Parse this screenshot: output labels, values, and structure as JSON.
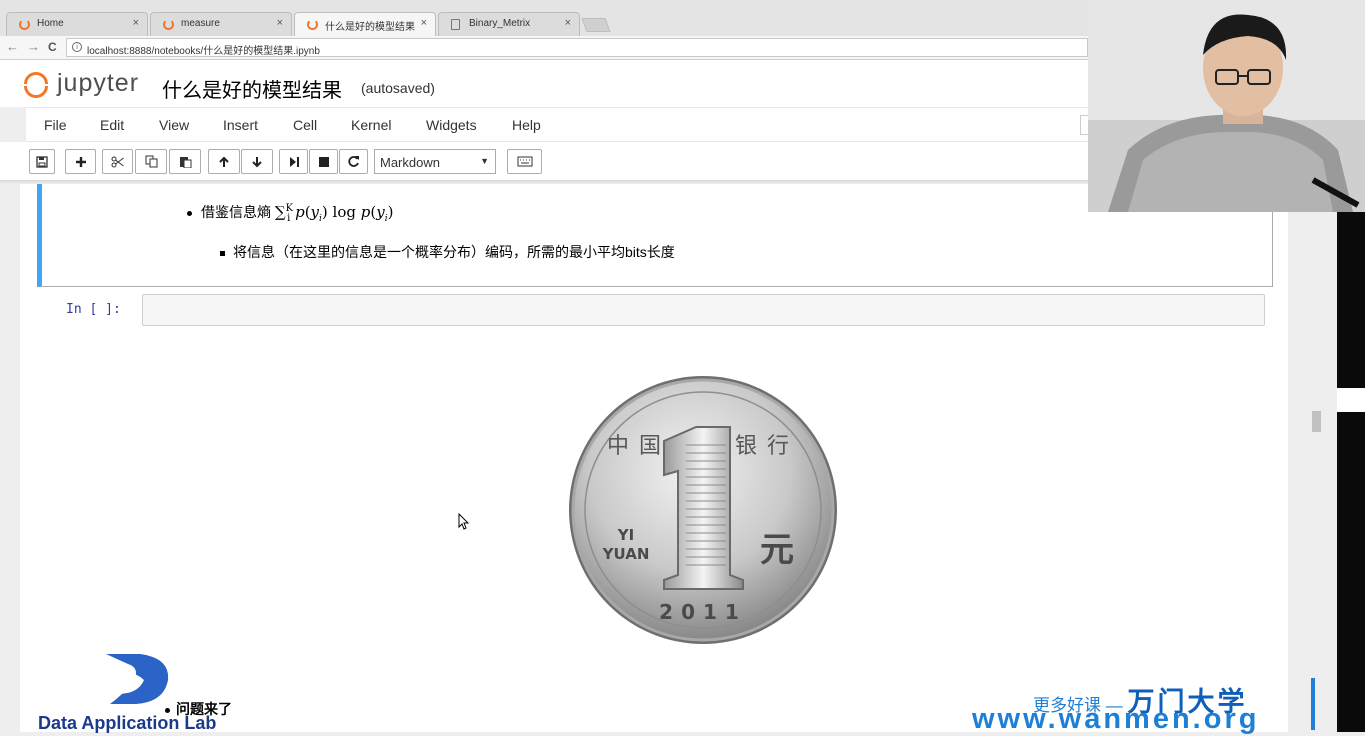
{
  "browser": {
    "tabs": [
      {
        "label": "Home",
        "active": false
      },
      {
        "label": "measure",
        "active": false
      },
      {
        "label": "什么是好的模型结果",
        "active": true
      },
      {
        "label": "Binary_Metrix",
        "active": false
      }
    ],
    "close_glyph": "×",
    "back_glyph": "←",
    "forward_glyph": "→",
    "reload_glyph": "C",
    "url": "localhost:8888/notebooks/什么是好的模型结果.ipynb"
  },
  "jupyter": {
    "logo_text": "jupyter",
    "notebook_title": "什么是好的模型结果",
    "save_status": "(autosaved)",
    "menu": [
      "File",
      "Edit",
      "View",
      "Insert",
      "Cell",
      "Kernel",
      "Widgets",
      "Help"
    ],
    "toolbar": {
      "cell_type": "Markdown",
      "buttons": [
        "save-icon",
        "plus-icon",
        "cut-icon",
        "copy-icon",
        "paste-icon",
        "arrow-up-icon",
        "arrow-down-icon",
        "run-icon",
        "stop-icon",
        "restart-icon",
        "keyboard-icon"
      ]
    }
  },
  "notebook": {
    "bullet_entropy_label": "借鉴信息熵",
    "bullet_entropy_math": "∑ p(yᵢ) log p(yᵢ)",
    "bullet_entropy_sup": "K",
    "bullet_entropy_sub": "i",
    "bullet_encoding": "将信息（在这里的信息是一个概率分布）编码，所需的最小平均bits长度",
    "input_prompt": "In [ ]:",
    "coin": {
      "top_text": "中国人民银行",
      "denomination": "1",
      "yuan_pinyin_1": "YI",
      "yuan_pinyin_2": "YUAN",
      "yuan_char": "元",
      "year": "2011"
    },
    "bullet_question": "问题来了"
  },
  "watermarks": {
    "lab_name": "Data Application Lab",
    "cn_slogan": "更多好课 —",
    "cn_brand": "万门大学",
    "url": "www.wanmen.org"
  }
}
